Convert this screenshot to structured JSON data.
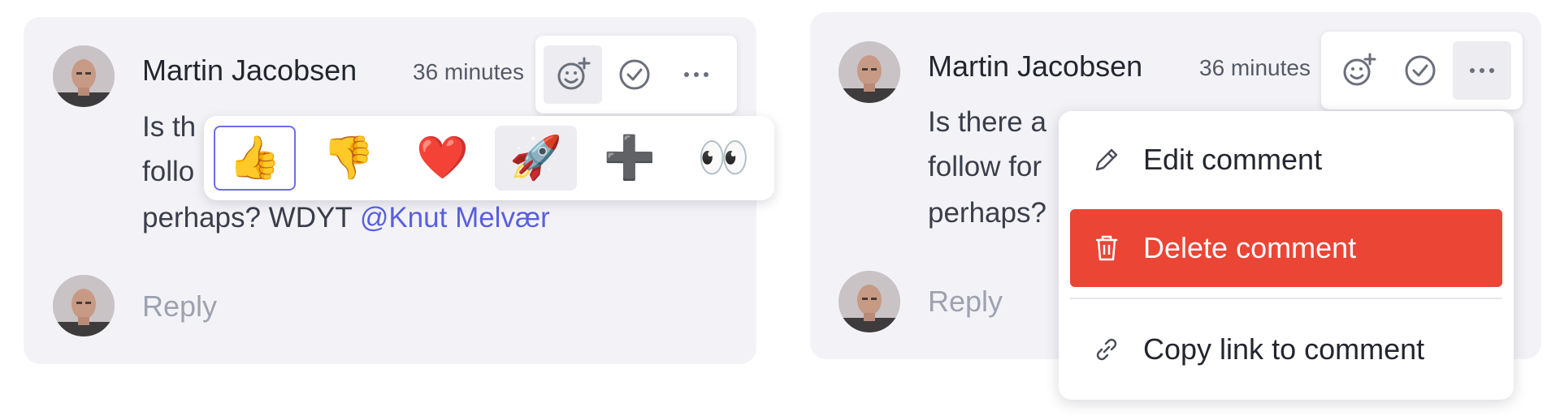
{
  "colors": {
    "card_bg": "#f3f3f7",
    "mention": "#5a5fe0",
    "danger": "#ea4535",
    "focus_ring": "#6c6ee8"
  },
  "left_panel": {
    "comment": {
      "author": "Martin Jacobsen",
      "time": "36 minutes",
      "visible_lines": [
        "Is th",
        "follo",
        "perhaps? WDYT "
      ],
      "mention": "@Knut Melvær"
    },
    "reply_placeholder": "Reply",
    "toolbar_icons": [
      "add-reaction-icon",
      "resolve-check-icon",
      "more-options-icon"
    ],
    "reactions": [
      {
        "emoji": "👍",
        "name": "thumbs-up"
      },
      {
        "emoji": "👎",
        "name": "thumbs-down"
      },
      {
        "emoji": "❤️",
        "name": "heart"
      },
      {
        "emoji": "🚀",
        "name": "rocket"
      },
      {
        "emoji": "➕",
        "name": "plus"
      },
      {
        "emoji": "👀",
        "name": "eyes"
      }
    ]
  },
  "right_panel": {
    "comment": {
      "author": "Martin Jacobsen",
      "time": "36 minutes",
      "visible_lines": [
        "Is there a",
        "follow for",
        "perhaps?"
      ]
    },
    "reply_placeholder": "Reply",
    "toolbar_icons": [
      "add-reaction-icon",
      "resolve-check-icon",
      "more-options-icon"
    ],
    "menu": {
      "edit_label": "Edit comment",
      "delete_label": "Delete comment",
      "copy_link_label": "Copy link to comment"
    }
  }
}
